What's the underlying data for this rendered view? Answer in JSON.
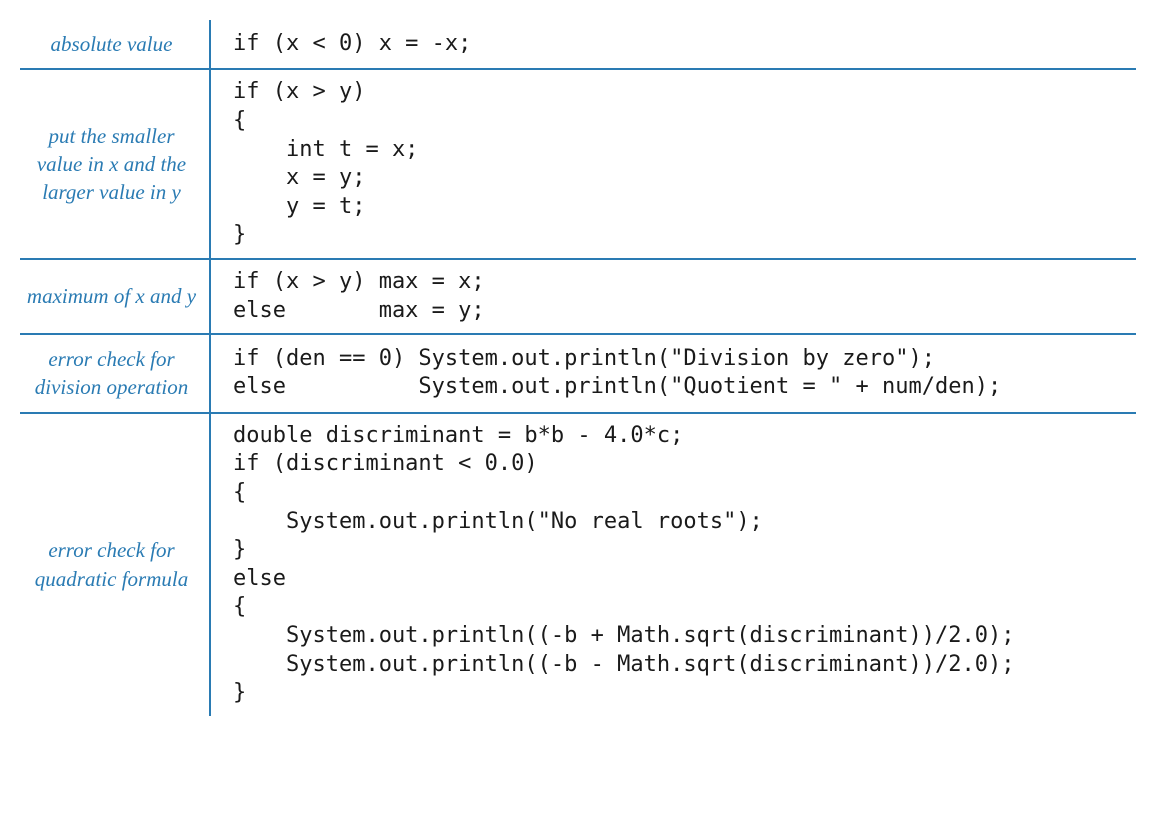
{
  "rows": [
    {
      "label": "absolute value",
      "code": "if (x < 0) x = -x;"
    },
    {
      "label": "put the smaller\nvalue in x\nand the larger\nvalue in y",
      "code": "if (x > y)\n{\n    int t = x;\n    x = y;\n    y = t;\n}"
    },
    {
      "label": "maximum of\nx and y",
      "code": "if (x > y) max = x;\nelse       max = y;"
    },
    {
      "label": "error check\nfor division\noperation",
      "code": "if (den == 0) System.out.println(\"Division by zero\");\nelse          System.out.println(\"Quotient = \" + num/den);"
    },
    {
      "label": "error check\nfor quadratic\nformula",
      "code": "double discriminant = b*b - 4.0*c;\nif (discriminant < 0.0)\n{\n    System.out.println(\"No real roots\");\n}\nelse\n{\n    System.out.println((-b + Math.sqrt(discriminant))/2.0);\n    System.out.println((-b - Math.sqrt(discriminant))/2.0);\n}"
    }
  ]
}
